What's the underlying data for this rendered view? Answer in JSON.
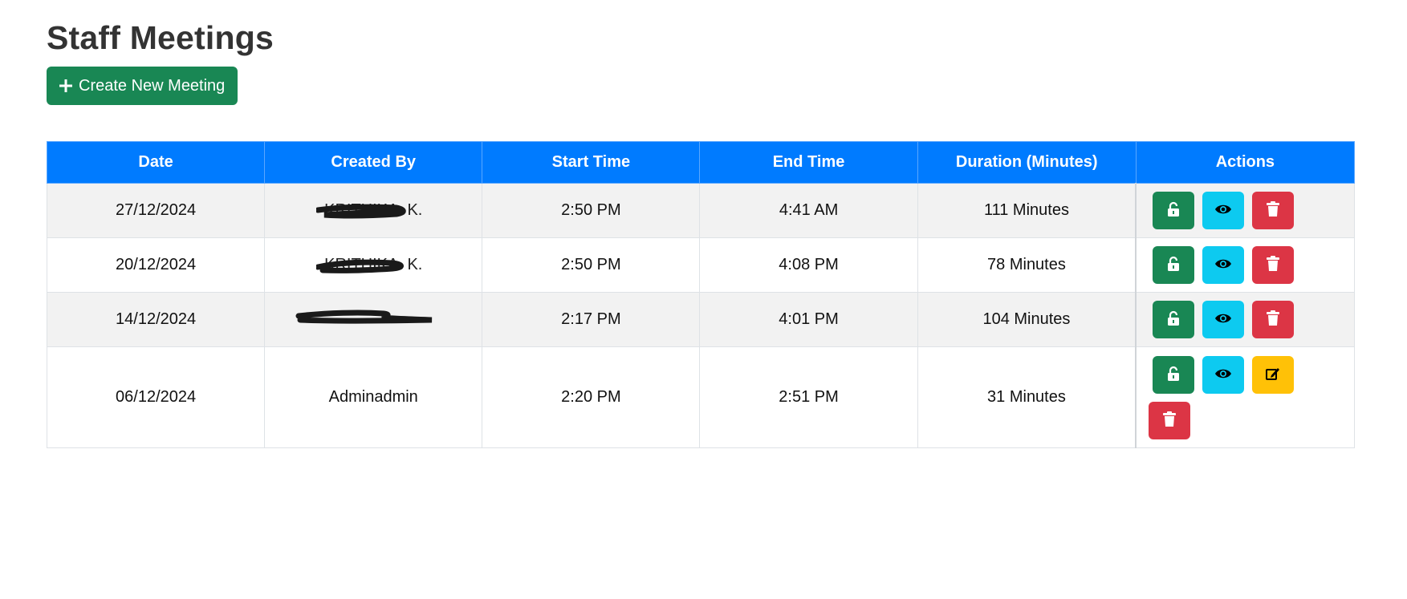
{
  "page": {
    "title": "Staff Meetings",
    "create_button_label": "Create New Meeting"
  },
  "table": {
    "headers": [
      "Date",
      "Created By",
      "Start Time",
      "End Time",
      "Duration (Minutes)",
      "Actions"
    ],
    "rows": [
      {
        "date": "27/12/2024",
        "created_by": "KRITHIKA. K.",
        "created_by_redacted": true,
        "start_time": "2:50 PM",
        "end_time": "4:41 AM",
        "duration": "111 Minutes",
        "actions": [
          "unlock",
          "view",
          "delete"
        ]
      },
      {
        "date": "20/12/2024",
        "created_by": "KRITHIKA. K.",
        "created_by_redacted": true,
        "start_time": "2:50 PM",
        "end_time": "4:08 PM",
        "duration": "78 Minutes",
        "actions": [
          "unlock",
          "view",
          "delete"
        ]
      },
      {
        "date": "14/12/2024",
        "created_by": "",
        "created_by_redacted": true,
        "start_time": "2:17 PM",
        "end_time": "4:01 PM",
        "duration": "104 Minutes",
        "actions": [
          "unlock",
          "view",
          "delete"
        ]
      },
      {
        "date": "06/12/2024",
        "created_by": "Adminadmin",
        "created_by_redacted": false,
        "start_time": "2:20 PM",
        "end_time": "2:51 PM",
        "duration": "31 Minutes",
        "actions": [
          "unlock",
          "view",
          "edit",
          "delete"
        ]
      }
    ]
  },
  "icons": {
    "create": "plus-icon",
    "unlock": "unlock-icon",
    "view": "eye-icon",
    "delete": "trash-icon",
    "edit": "edit-icon"
  },
  "colors": {
    "header_bg": "#007bff",
    "success": "#198754",
    "info": "#0dcaf0",
    "danger": "#dc3545",
    "warning": "#ffc107",
    "title": "#333333"
  }
}
